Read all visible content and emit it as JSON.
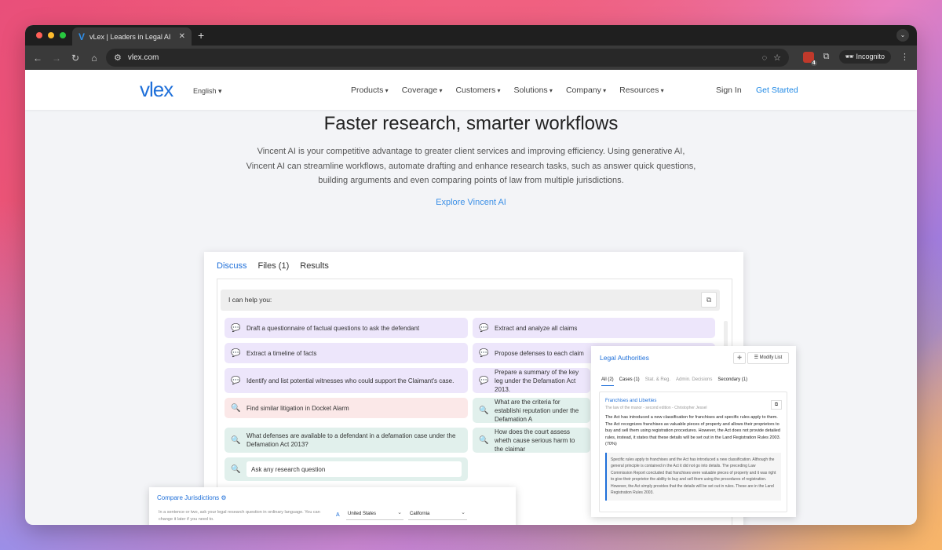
{
  "browser": {
    "tab_title": "vLex | Leaders in Legal AI",
    "tab_favicon": "V",
    "url": "vlex.com",
    "profile": "Incognito",
    "extension_badge": "4"
  },
  "nav": {
    "logo": "vlex",
    "language": "English",
    "menu": [
      "Products",
      "Coverage",
      "Customers",
      "Solutions",
      "Company",
      "Resources"
    ],
    "sign_in": "Sign In",
    "get_started": "Get Started"
  },
  "hero": {
    "title": "Faster research, smarter workflows",
    "description": "Vincent AI is your competitive advantage to greater client services and improving efficiency. Using generative AI, Vincent AI can streamline workflows, automate drafting and enhance research tasks, such as answer quick questions, building arguments and even comparing points of law from multiple jurisdictions.",
    "cta": "Explore Vincent AI"
  },
  "panel": {
    "tabs": [
      "Discuss",
      "Files (1)",
      "Results"
    ],
    "help_text": "I can help you:",
    "chips": [
      "Draft a questionnaire of factual questions to ask the defendant",
      "Extract and analyze all claims",
      "Extract a timeline of facts",
      "Propose defenses to each claim",
      "Identify and list potential witnesses who could support the Claimant's case.",
      "Prepare a summary of the key leg under the Defamation Act 2013.",
      "Find similar litigation in Docket Alarm",
      "What are the criteria for establishi reputation under the Defamation A",
      "What defenses are available to a defendant in a defamation case under the Defamation Act 2013?",
      "How does the court assess wheth cause serious harm to the claimar"
    ],
    "ask_placeholder": "Ask any research question"
  },
  "legal": {
    "title": "Legal Authorities",
    "modify": "Modify List",
    "tabs": [
      "All (2)",
      "Cases (1)",
      "Stat. & Reg.",
      "Admin. Decisions",
      "Secondary (1)"
    ],
    "doc_title": "Franchises and Liberties",
    "doc_source": "The law of the manor - second edition - Christopher Jessel",
    "doc_body": "The Act has introduced a new classification for franchises and specific rules apply to them. The Act recognizes franchises as valuable pieces of property and allows their proprietors to buy and sell them using registration procedures. However, the Act does not provide detailed rules, instead, it states that these details will be set out in the Land Registration Rules 2003. (70%)",
    "doc_quote": "Specific rules apply to franchises and the Act has introduced a new classification. Although the general principle is contained in the Act it did not go into details. The preceding Law Commission Report concluded that franchises were valuable pieces of property and it was right to give their proprietor the ability to buy and sell them using the procedures of registration. However, the Act simply provides that the details will be set out in rules. These are in the Land Registration Rules 2003."
  },
  "compare": {
    "title": "Compare Jurisdictions",
    "desc": "In a sentence or two, ask your legal research question in ordinary language. You can change it later if you need to.",
    "row_label": "A",
    "country": "United States",
    "state": "California"
  }
}
